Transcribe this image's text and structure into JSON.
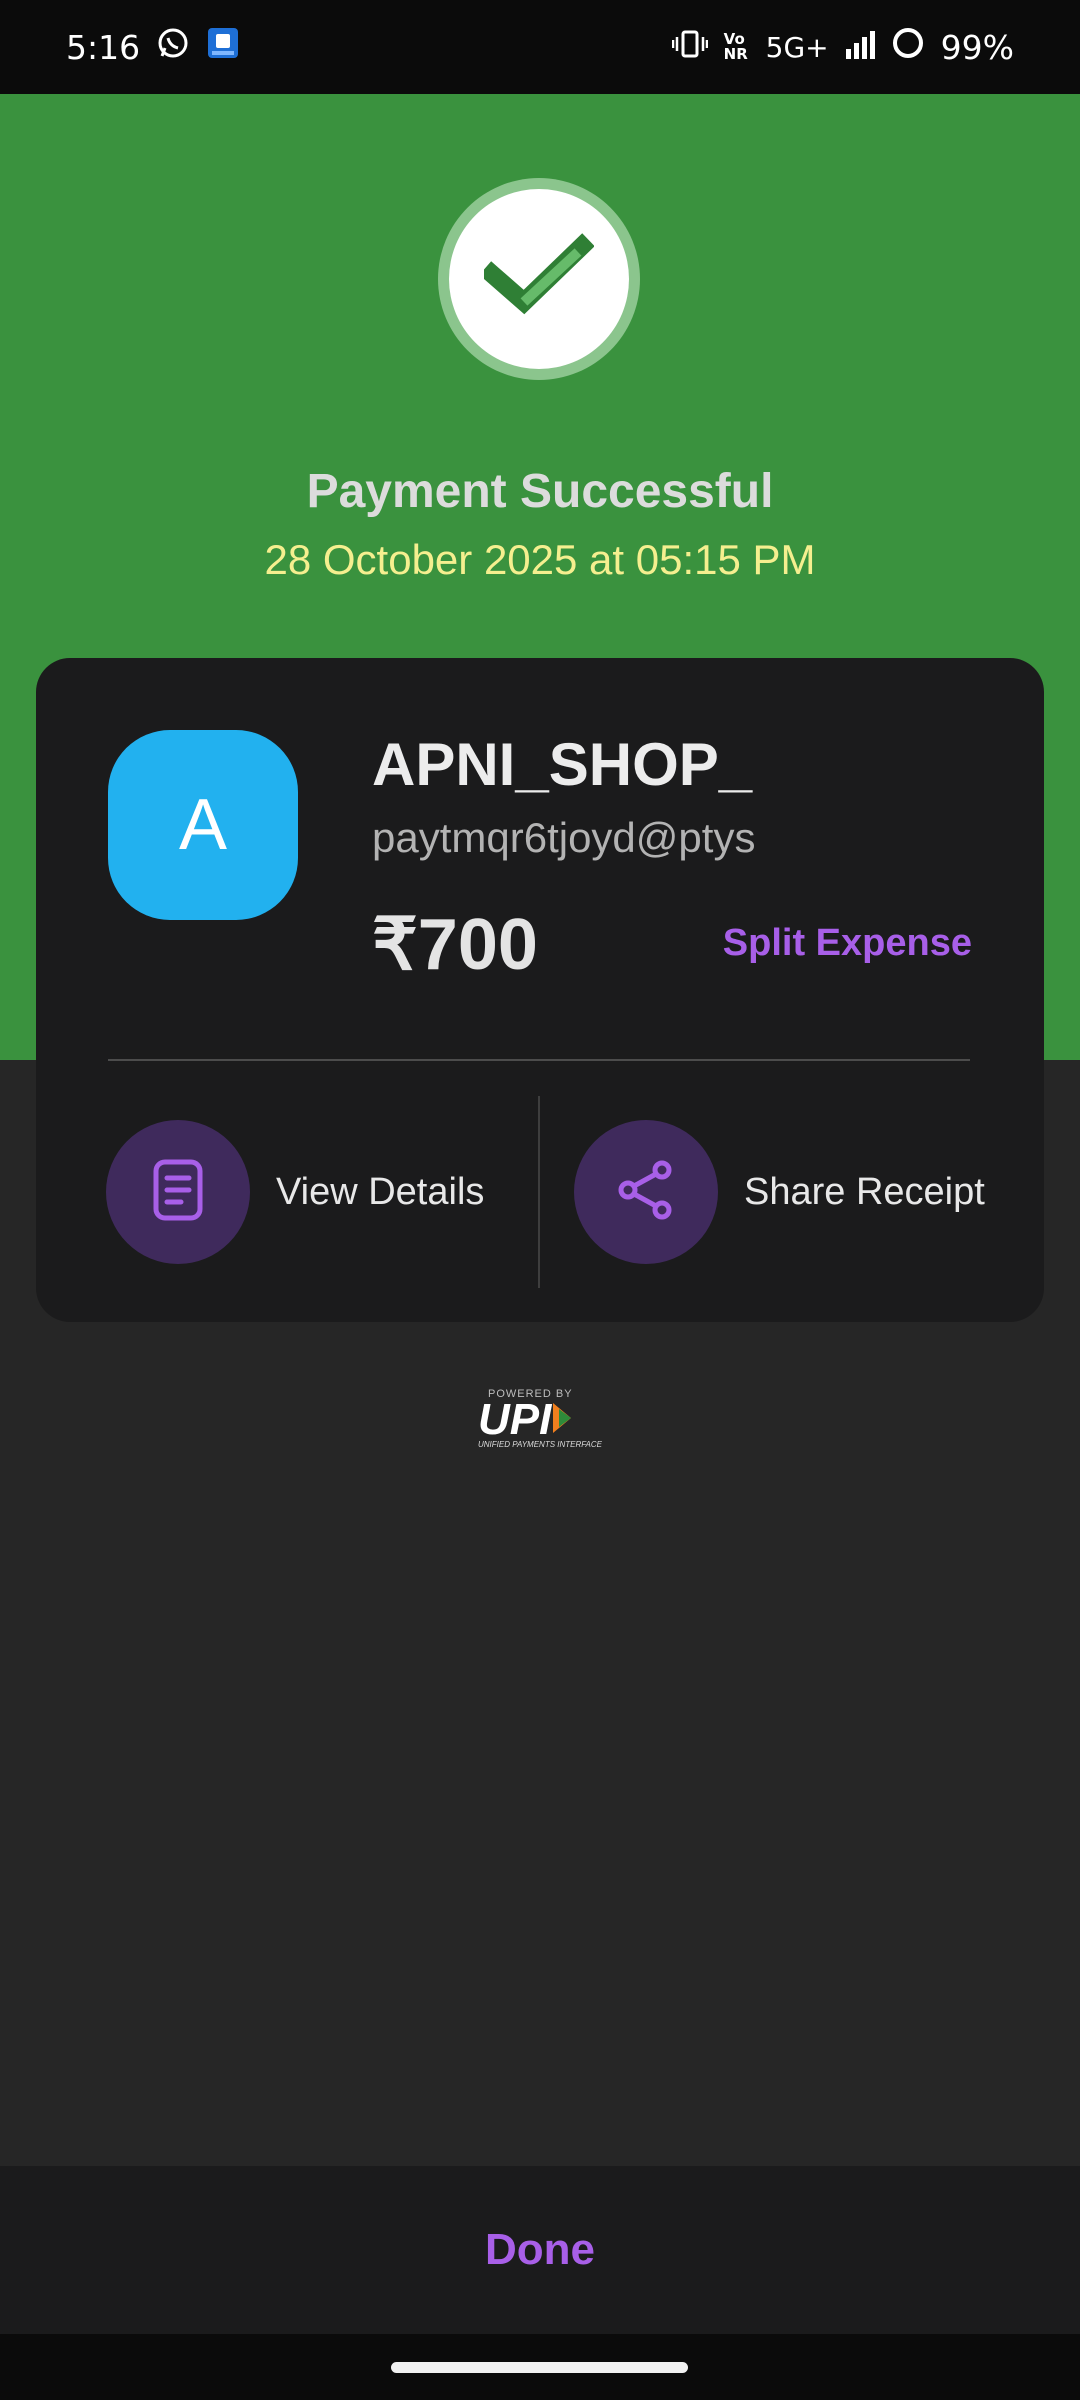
{
  "status_bar": {
    "time": "5:16",
    "network": "5G+",
    "volte": "Vo NR",
    "battery": "99%",
    "icons": [
      "whatsapp-icon",
      "app-notification-icon",
      "vibrate-icon",
      "volte-icon",
      "signal-icon",
      "battery-icon"
    ]
  },
  "header": {
    "title": "Payment Successful",
    "datetime": "28 October 2025 at 05:15 PM",
    "check_icon": "check-icon"
  },
  "card": {
    "avatar_letter": "A",
    "merchant_name": "APNI_SHOP_",
    "upi_id": "paytmqr6tjoyd@ptys",
    "amount": "₹700",
    "split_label": "Split Expense",
    "actions": [
      {
        "label": "View Details",
        "icon": "document-icon"
      },
      {
        "label": "Share Receipt",
        "icon": "share-icon"
      }
    ]
  },
  "upi_logo": {
    "powered": "POWERED BY",
    "word": "UPI",
    "sub": "UNIFIED PAYMENTS INTERFACE"
  },
  "footer": {
    "done_label": "Done"
  },
  "colors": {
    "green": "#3a923e",
    "accent": "#a85fe8",
    "avatar": "#22b1ef",
    "date": "#f5ef8f"
  }
}
